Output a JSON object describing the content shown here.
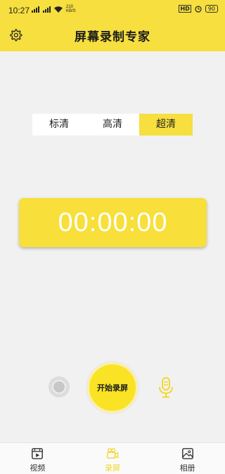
{
  "status_bar": {
    "time": "10:27",
    "net_speed_value": "210",
    "net_speed_unit": "KB/S",
    "hd_tag": "HD",
    "battery": "90"
  },
  "header": {
    "title": "屏幕录制专家"
  },
  "quality": {
    "options": [
      "标清",
      "高清",
      "超清"
    ],
    "selected": "超清"
  },
  "timer": {
    "value": "00:00:00"
  },
  "controls": {
    "start_label": "开始录屏"
  },
  "bottom_nav": {
    "items": [
      {
        "label": "视频",
        "icon": "video-icon"
      },
      {
        "label": "录屏",
        "icon": "camera-record-icon"
      },
      {
        "label": "相册",
        "icon": "album-icon"
      }
    ],
    "active": "录屏"
  },
  "colors": {
    "accent": "#f6df3e",
    "background": "#f1f1f1",
    "timer_text": "#ffffff"
  }
}
